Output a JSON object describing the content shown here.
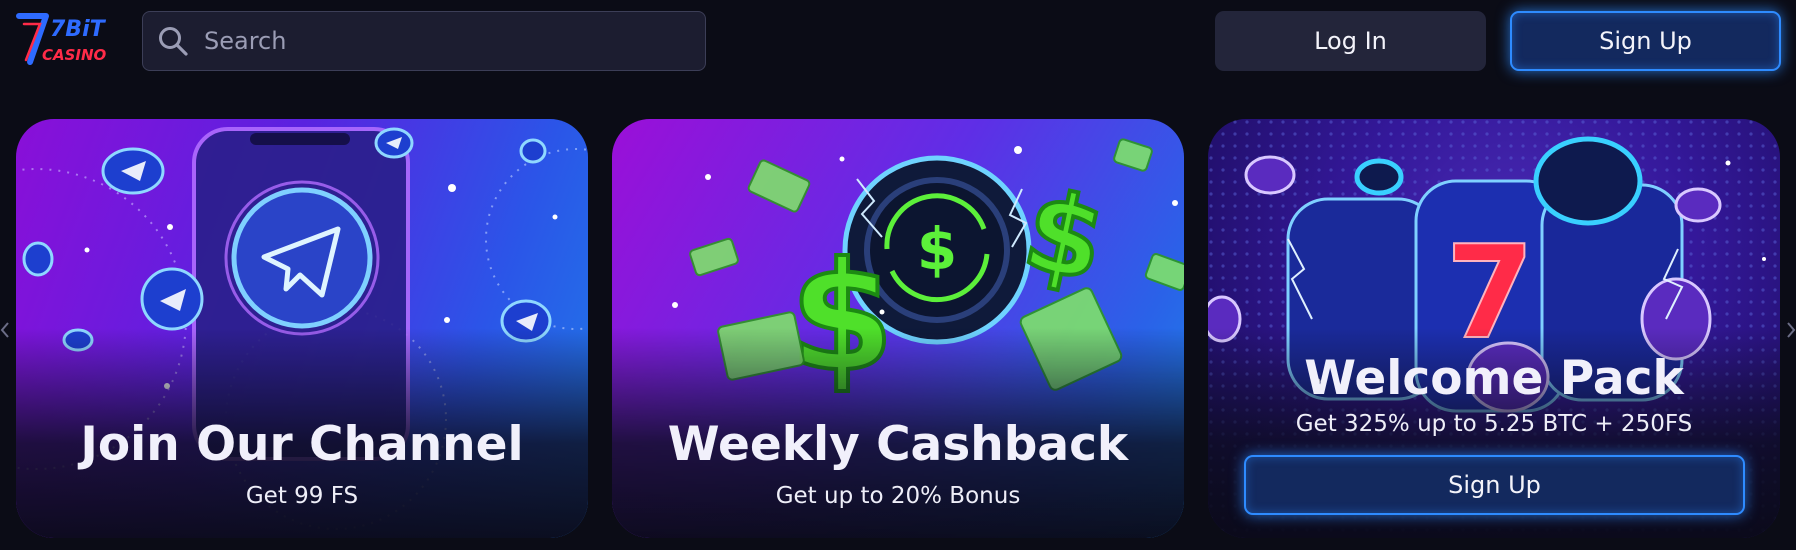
{
  "header": {
    "logo": {
      "brand_top": "7BiT",
      "brand_bottom": "CASINO"
    },
    "search": {
      "placeholder": "Search",
      "value": ""
    },
    "login_label": "Log In",
    "signup_label": "Sign Up"
  },
  "promos": [
    {
      "title": "Join Our Channel",
      "subtitle": "Get 99 FS",
      "icon": "telegram-icon"
    },
    {
      "title": "Weekly Cashback",
      "subtitle": "Get up to 20% Bonus",
      "icon": "dollar-icon"
    },
    {
      "title": "Welcome Pack",
      "subtitle": "Get 325% up to 5.25 BTC + 250FS",
      "button_label": "Sign Up",
      "icon": "slot-reel-icon"
    }
  ],
  "colors": {
    "background": "#0b0c16",
    "accent": "#2e8bff",
    "slot_seven": "#ff2b48",
    "cash_green": "#5cf03a"
  }
}
